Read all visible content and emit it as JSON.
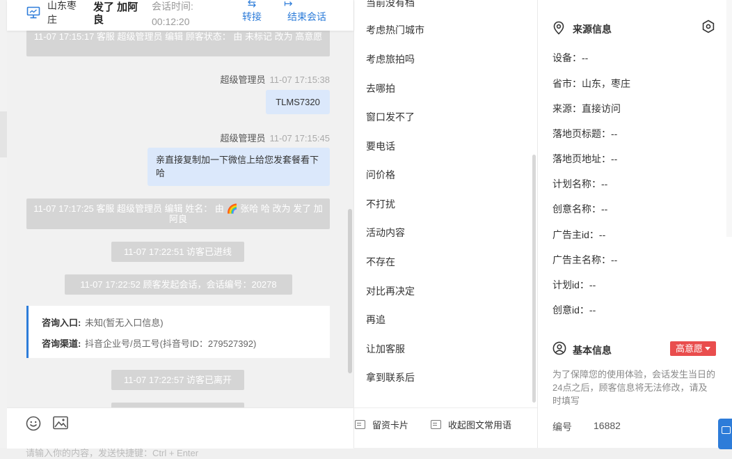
{
  "header": {
    "location": "山东枣庄",
    "visitor_name": "发了 加阿良",
    "session_time_label": "会话时间:",
    "session_time": "00:12:20",
    "transfer_label": "转接",
    "end_label": "结束会话"
  },
  "messages": {
    "sys1": "11-07 17:15:17 客服 超级管理员 编辑 顾客状态： 由 未标记 改为 高意愿",
    "msg1_sender": "超级管理员",
    "msg1_time": "11-07 17:15:38",
    "msg1_text": "TLMS7320",
    "msg2_sender": "超级管理员",
    "msg2_time": "11-07 17:15:45",
    "msg2_text": "亲直接复制加一下微信上给您发套餐看下哈",
    "sys2": "11-07 17:17:25 客服 超级管理员 编辑 姓名： 由 🌈 张哈 哈 改为 发了 加阿良",
    "sys3": "11-07 17:22:51 访客已进线",
    "sys4": "11-07 17:22:52 顾客发起会话，会话编号：20278",
    "entry_label": "咨询入口:",
    "entry_value": "未知(暂无入口信息)",
    "channel_label": "咨询渠道:",
    "channel_value": "抖音企业号/员工号(抖音号ID：279527392)",
    "sys5": "11-07 17:22:57 访客已离开"
  },
  "input": {
    "placeholder": "请输入你的内容，发送快捷键：Ctrl + Enter"
  },
  "phrases": {
    "items": [
      "当前没有档",
      "考虑热门城市",
      "考虑旅拍吗",
      "去哪拍",
      "窗口发不了",
      "要电话",
      "问价格",
      "不打扰",
      "活动内容",
      "不存在",
      "对比再决定",
      "再追",
      "让加客服",
      "拿到联系后"
    ]
  },
  "phrase_tools": {
    "card_label": "留资卡片",
    "fold_label": "收起图文常用语"
  },
  "source_info": {
    "title": "来源信息",
    "fields": [
      {
        "label": "设备：",
        "value": "--"
      },
      {
        "label": "省市：",
        "value": "山东，枣庄"
      },
      {
        "label": "来源：",
        "value": "直接访问"
      },
      {
        "label": "落地页标题：",
        "value": "--"
      },
      {
        "label": "落地页地址：",
        "value": "--"
      },
      {
        "label": "计划名称：",
        "value": "--"
      },
      {
        "label": "创意名称：",
        "value": "--"
      },
      {
        "label": "广告主id：",
        "value": "--"
      },
      {
        "label": "广告主名称：",
        "value": "--"
      },
      {
        "label": "计划id：",
        "value": "--"
      },
      {
        "label": "创意id：",
        "value": "--"
      }
    ]
  },
  "basic_info": {
    "title": "基本信息",
    "intent": "高意愿",
    "notice": "为了保障您的使用体验，会话发生当日的24点之后，顾客信息将无法修改，请及时填写",
    "id_label": "编号",
    "id_value": "16882"
  },
  "colors": {
    "accent": "#2d7cd9",
    "badge": "#e94d4d",
    "bubble": "#dbe8fb"
  }
}
